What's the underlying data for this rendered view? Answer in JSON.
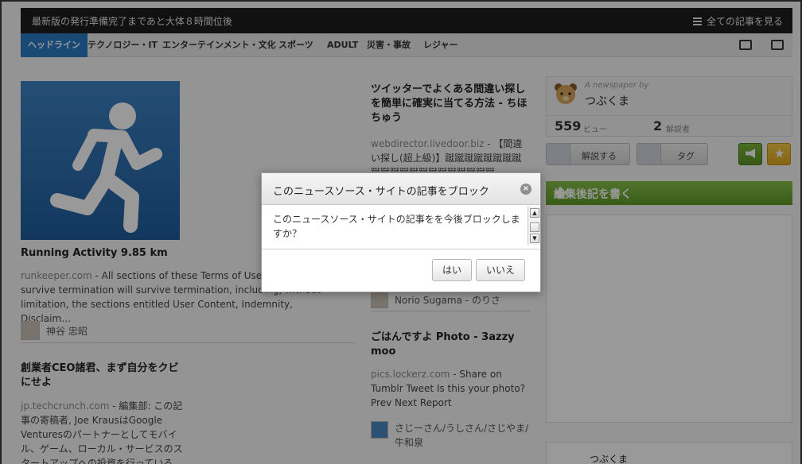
{
  "topbar": {
    "status": "最新版の発行準備完了まであと大体８時間位後",
    "all_articles": "全ての記事を見る"
  },
  "nav": {
    "tabs": [
      "ヘッドライン",
      "テクノロジー・IT",
      "エンターテインメント・文化",
      "スポーツ",
      "ADULT",
      "災害・事故",
      "レジャー"
    ],
    "active_tab": "ヘッドライン",
    "icons": [
      "video-icon",
      "image-icon"
    ]
  },
  "articles": {
    "a1": {
      "title": "Running Activity 9.85 km",
      "source": "runkeeper.com",
      "excerpt": " - All sections of these Terms of Use that should survive termination will survive termination, including, without limitation, the sections entitled User Content, Indemnity, Disclaim…",
      "author": "神谷 忠昭"
    },
    "a2": {
      "title": "創業者CEO諸君、まず自分をクビにせよ",
      "source": "jp.techcrunch.com",
      "excerpt": " - 編集部: この記事の寄稿者, Joe KrausはGoogle Venturesのパートナーとしてモバイル、ゲーム、ローカル・サービスのスタートアップへの投資を行っている"
    },
    "a3": {
      "title": "ツイッターでよくある間違い探しを簡単に確実に当てる方法 - ちほちゅう",
      "source": "webdirector.livedoor.biz",
      "excerpt": " - 【間違い探し(超上級)】蹴蹴蹴蹴蹴蹴蹴蹴蹴蹴蹴蹴蹴蹴蹴蹴蹴蹴蹴蹴蹴",
      "author": "Norio Sugama - のりさ"
    },
    "a4": {
      "title": "ごはんですよ Photo - 3azzy moo",
      "source": "pics.lockerz.com",
      "excerpt": " - Share on Tumblr Tweet Is this your photo? Prev Next Report",
      "author": "さじーさん/うしさん/さじやま/牛和泉"
    }
  },
  "sidebar": {
    "byline": "A newspaper by",
    "owner": "つぶくま",
    "views_num": "559",
    "views_label": "ビュー",
    "comments_num": "2",
    "comments_label": "解説者",
    "explain_btn": "解説する",
    "tag_btn": "タグ",
    "write_btn": "編集後記を書く",
    "bottom_name": "つぶくま"
  },
  "dialog": {
    "title": "このニュースソース・サイトの記事をブロック",
    "message": "このニュースソース・サイトの記事をを今後ブロックしますか？",
    "yes": "はい",
    "no": "いいえ"
  },
  "colors": {
    "nav_active": "#2a7cc4",
    "green": "#6aa832",
    "gold": "#e8b52a",
    "hero": "#2d6fb0"
  }
}
